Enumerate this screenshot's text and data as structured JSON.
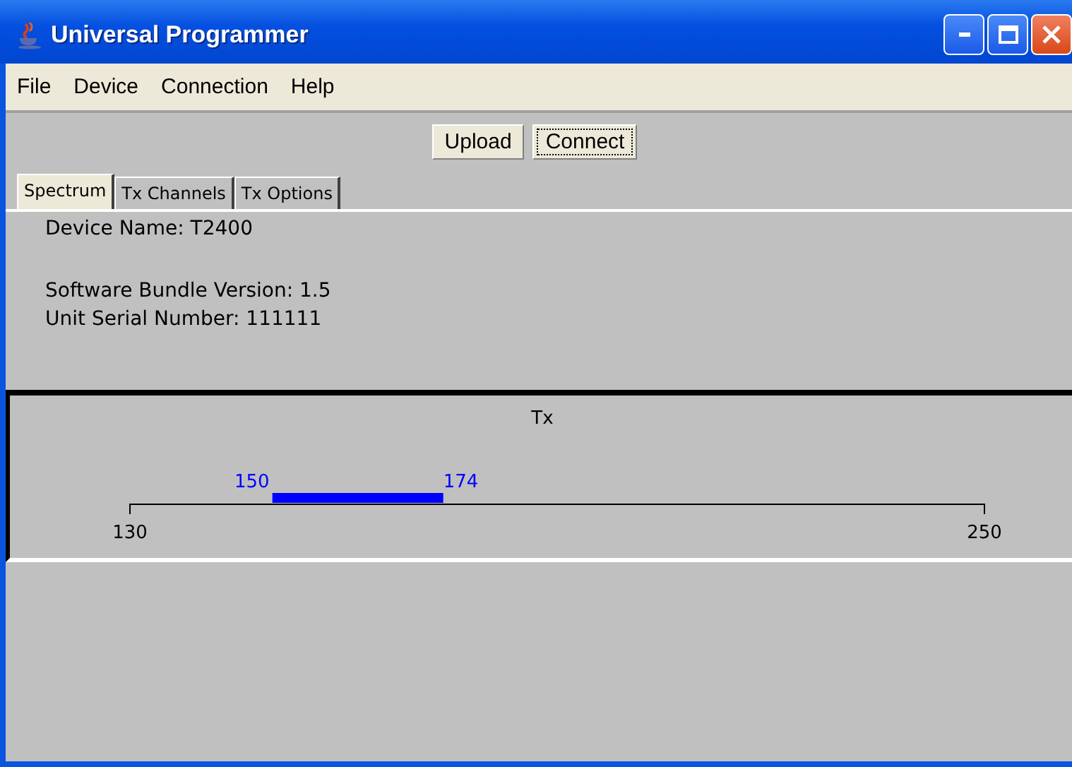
{
  "window": {
    "title": "Universal Programmer"
  },
  "menu": [
    "File",
    "Device",
    "Connection",
    "Help"
  ],
  "toolbar": [
    {
      "label": "Upload",
      "focused": false
    },
    {
      "label": "Connect",
      "focused": true
    }
  ],
  "tabs": [
    {
      "label": "Spectrum",
      "selected": true
    },
    {
      "label": "Tx Channels",
      "selected": false
    },
    {
      "label": "Tx Options",
      "selected": false
    }
  ],
  "device_name": "Device Name: T2400",
  "details": [
    "Software Bundle Version: 1.5",
    "Unit Serial Number: 111111"
  ],
  "spectrum": {
    "title": "Tx",
    "scale_start": "130",
    "scale_end": "250",
    "band_start": "150",
    "band_end": "174"
  }
}
